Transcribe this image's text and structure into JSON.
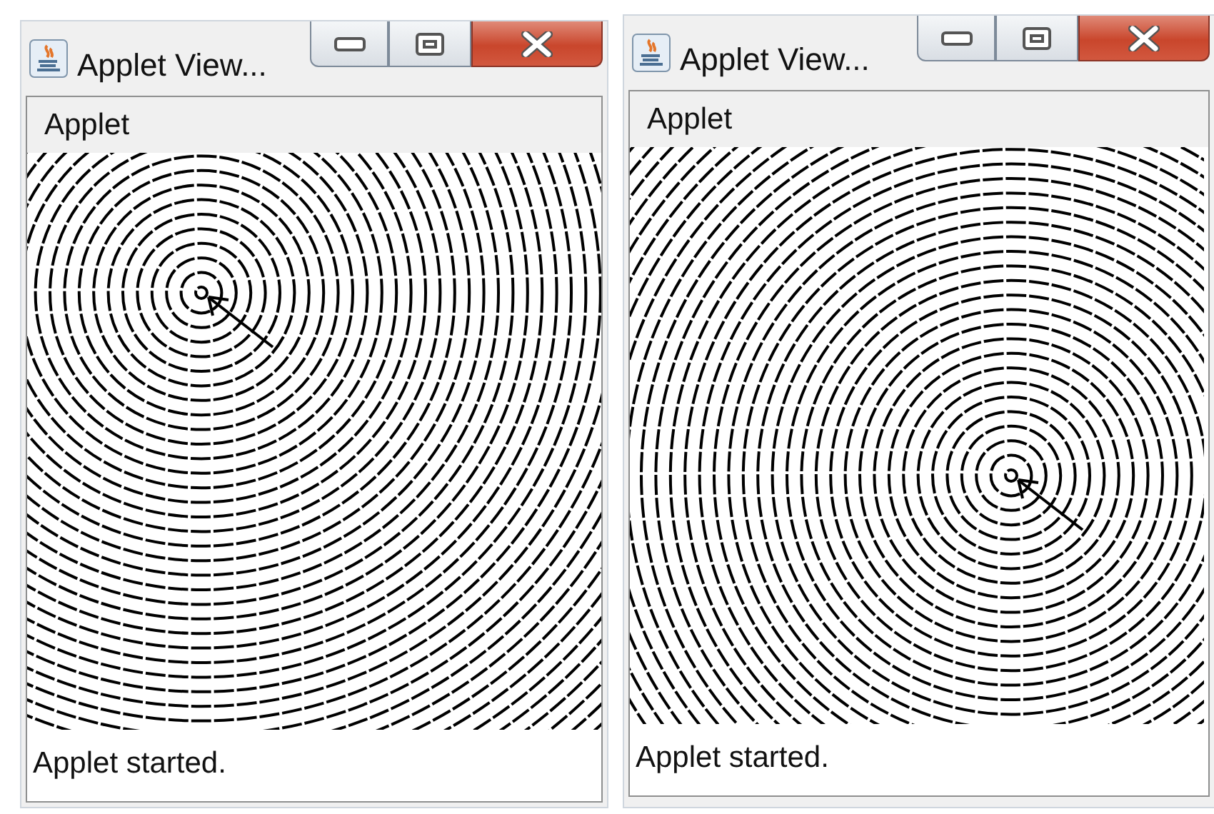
{
  "windows": [
    {
      "title": "Applet View...",
      "menu": [
        "Applet"
      ],
      "status": "Applet started."
    },
    {
      "title": "Applet View...",
      "menu": [
        "Applet"
      ],
      "status": "Applet started."
    }
  ]
}
